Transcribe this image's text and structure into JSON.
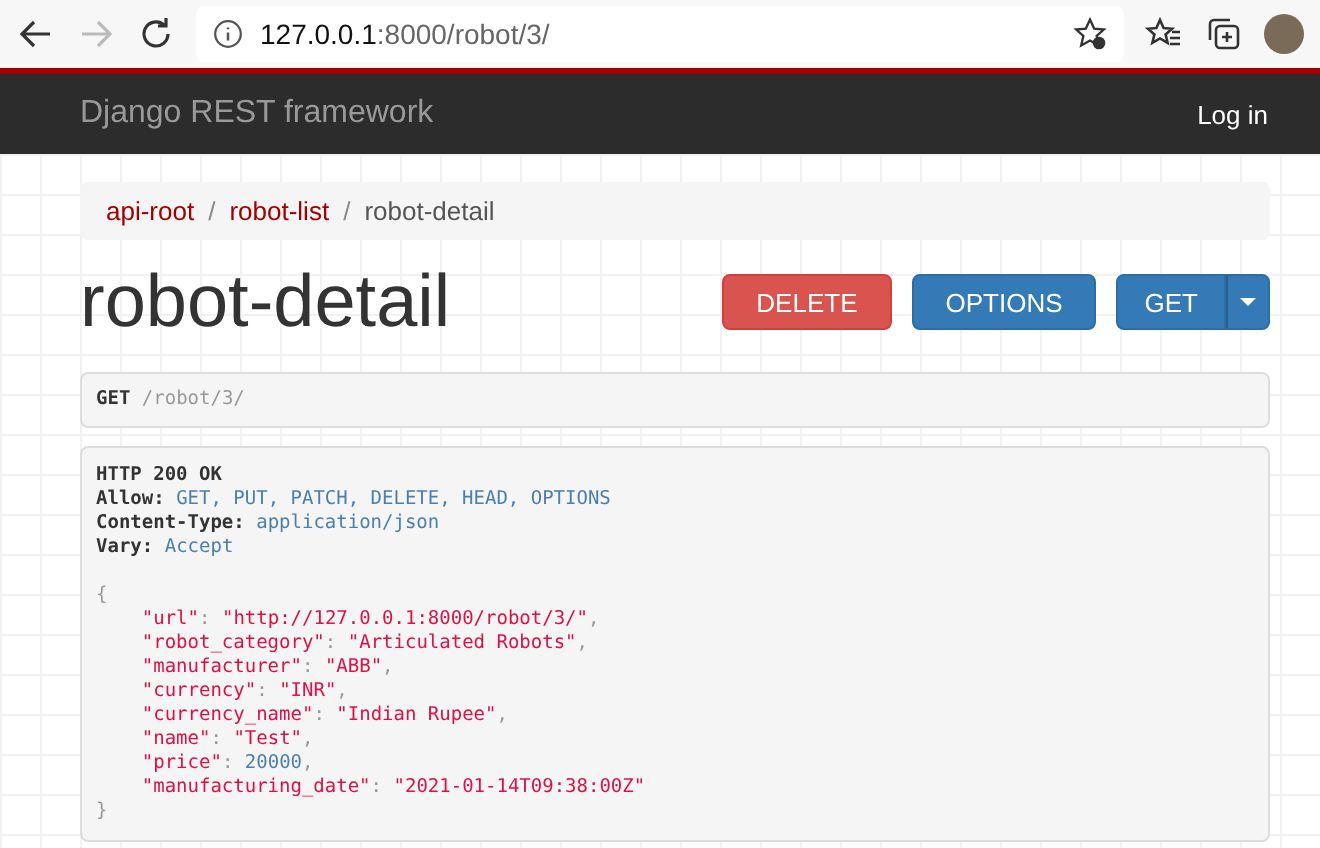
{
  "browser": {
    "address_host": "127.0.0.1",
    "address_path": ":8000/robot/3/"
  },
  "navbar": {
    "brand": "Django REST framework",
    "login": "Log in"
  },
  "breadcrumbs": [
    {
      "label": "api-root",
      "selected": false
    },
    {
      "separator": "/",
      "label": "robot-list",
      "selected": false
    },
    {
      "separator": "/",
      "label": "robot-detail",
      "selected": true
    }
  ],
  "title": "robot-detail",
  "buttons": [
    {
      "label": "DELETE",
      "kind": "danger"
    },
    {
      "label": "OPTIONS",
      "kind": "primary"
    },
    {
      "label": "GET",
      "kind": "split"
    }
  ],
  "request": {
    "method": "GET",
    "path": "/robot/3/"
  },
  "response": {
    "status": "HTTP 200 OK",
    "headers": [
      {
        "name": "Allow:",
        "value": "GET, PUT, PATCH, DELETE, HEAD, OPTIONS"
      },
      {
        "name": "Content-Type:",
        "value": "application/json"
      },
      {
        "name": "Vary:",
        "value": "Accept"
      }
    ],
    "open": "{",
    "fields": [
      {
        "key": "\"url\"",
        "colon": ":",
        "value": "\"http://127.0.0.1:8000/robot/3/\"",
        "kind": "string",
        "comma": ","
      },
      {
        "key": "\"robot_category\"",
        "colon": ":",
        "value": "\"Articulated Robots\"",
        "kind": "string",
        "comma": ","
      },
      {
        "key": "\"manufacturer\"",
        "colon": ":",
        "value": "\"ABB\"",
        "kind": "string",
        "comma": ","
      },
      {
        "key": "\"currency\"",
        "colon": ":",
        "value": "\"INR\"",
        "kind": "string",
        "comma": ","
      },
      {
        "key": "\"currency_name\"",
        "colon": ":",
        "value": "\"Indian Rupee\"",
        "kind": "string",
        "comma": ","
      },
      {
        "key": "\"name\"",
        "colon": ":",
        "value": "\"Test\"",
        "kind": "string",
        "comma": ","
      },
      {
        "key": "\"price\"",
        "colon": ":",
        "value": "20000",
        "kind": "number",
        "comma": ","
      },
      {
        "key": "\"manufacturing_date\"",
        "colon": ":",
        "value": "\"2021-01-14T09:38:00Z\"",
        "kind": "string"
      }
    ],
    "close": "}"
  }
}
